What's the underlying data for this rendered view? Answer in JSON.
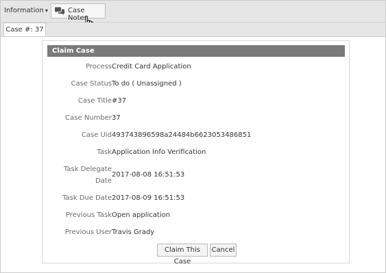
{
  "toolbar": {
    "information_label": "Information",
    "case_notes_label": "Case Notes"
  },
  "tab": {
    "label": "Case #: 37"
  },
  "panel": {
    "title": "Claim Case",
    "rows": [
      {
        "label": "Process",
        "value": "Credit Card Application"
      },
      {
        "label": "Case Status",
        "value": "To do ( Unassigned )"
      },
      {
        "label": "Case Title",
        "value": "#37"
      },
      {
        "label": "Case Number",
        "value": "37"
      },
      {
        "label": "Case Uid",
        "value": "493743896598a24484b6623053486851"
      },
      {
        "label": "Task",
        "value": "Application Info Verification"
      },
      {
        "label": "Task Delegate",
        "label2": "Date",
        "value": "2017-08-08 16:51:53"
      },
      {
        "label": "Task Due Date",
        "value": "2017-08-09 16:51:53"
      },
      {
        "label": "Previous Task",
        "value": "Open application"
      },
      {
        "label": "Previous User",
        "value": "Travis Grady"
      }
    ],
    "claim_button": "Claim This Case",
    "cancel_button": "Cancel"
  },
  "colors": {
    "toolbar_bg": "#e6e6e6",
    "panel_header_bg": "#7a7a7a"
  },
  "icons": [
    "chat-icon",
    "caret-down-icon",
    "hand-cursor-icon"
  ]
}
